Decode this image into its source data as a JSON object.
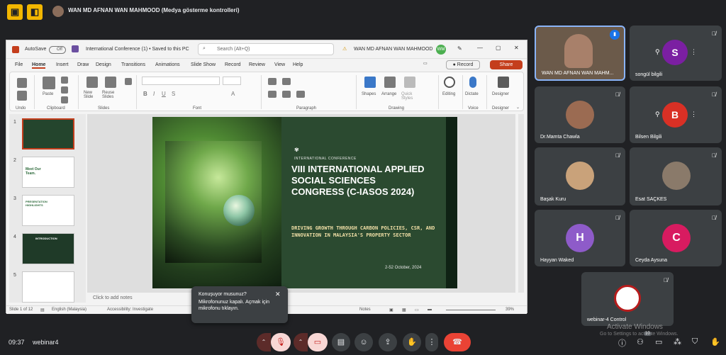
{
  "meet": {
    "presenter_label": "WAN MD AFNAN WAN MAHMOOD (Medya gösterme kontrolleri)",
    "time": "09:37",
    "meeting_code": "webinar4",
    "people_badge": "10",
    "activate_windows_title": "Activate Windows",
    "activate_windows_sub": "Go to Settings to activate Windows.",
    "toast": {
      "title": "Konuşuyor musunuz?",
      "body": "Mikrofonunuz kapalı. Açmak için mikrofonu tıklayın.",
      "close": "✕"
    },
    "participants": [
      {
        "name": "WAN MD AFNAN WAN MAHM...",
        "kind": "video"
      },
      {
        "name": "songül bilgili",
        "initial": "S",
        "color": "#7b1fa2"
      },
      {
        "name": "Dr.Mamta Chawla",
        "kind": "photo"
      },
      {
        "name": "Bilsen Bilgili",
        "initial": "B",
        "color": "#d93025"
      },
      {
        "name": "Başak Kuru",
        "kind": "photo"
      },
      {
        "name": "Esat SAÇKES",
        "kind": "photo"
      },
      {
        "name": "Hayyan Waked",
        "initial": "H",
        "color": "#8e5bc9"
      },
      {
        "name": "Ceyda Aysuna",
        "initial": "C",
        "color": "#d81b60"
      },
      {
        "name": "webinar-4 Control",
        "kind": "logo"
      }
    ]
  },
  "ppt": {
    "autosave": "AutoSave",
    "autosave_state": "Off",
    "doc_title": "International Conference (1) • Saved to this PC",
    "search_placeholder": "Search (Alt+Q)",
    "user": "WAN MD AFNAN WAN MAHMOOD",
    "user_initials": "WM",
    "record": "Record",
    "share": "Share",
    "menu": [
      "File",
      "Home",
      "Insert",
      "Draw",
      "Design",
      "Transitions",
      "Animations",
      "Slide Show",
      "Record",
      "Review",
      "View",
      "Help"
    ],
    "groups": [
      "Undo",
      "Clipboard",
      "Slides",
      "Font",
      "Paragraph",
      "Drawing",
      "Voice",
      "Designer"
    ],
    "ribbon": {
      "paste": "Paste",
      "new_slide": "New Slide",
      "reuse_slides": "Reuse Slides",
      "shapes": "Shapes",
      "arrange": "Arrange",
      "quick_styles": "Quick Styles",
      "editing": "Editing",
      "dictate": "Dictate",
      "designer": "Designer"
    },
    "thumb_numbers": [
      "1",
      "2",
      "3",
      "4",
      "5"
    ],
    "thumb_texts": [
      "",
      "Meet Our Team.",
      "PRESENTATION HIGHLIGHTS",
      "INTRODUCTION",
      ""
    ],
    "notes_placeholder": "Click to add notes",
    "status": {
      "slide": "Slide 1 of 12",
      "lang": "English (Malaysia)",
      "access": "Accessibility: Investigate",
      "notes": "Notes",
      "zoom": "39%"
    },
    "slide": {
      "kicker": "INTERNATIONAL CONFERENCE",
      "title": "VIII INTERNATIONAL APPLIED SOCIAL SCIENCES CONGRESS (C-IASOS 2024)",
      "subtitle": "DRIVING GROWTH THROUGH CARBON POLICIES, CSR, AND INNOVATION IN MALAYSIA'S PROPERTY SECTOR",
      "date": "2-52 October, 2024"
    }
  }
}
